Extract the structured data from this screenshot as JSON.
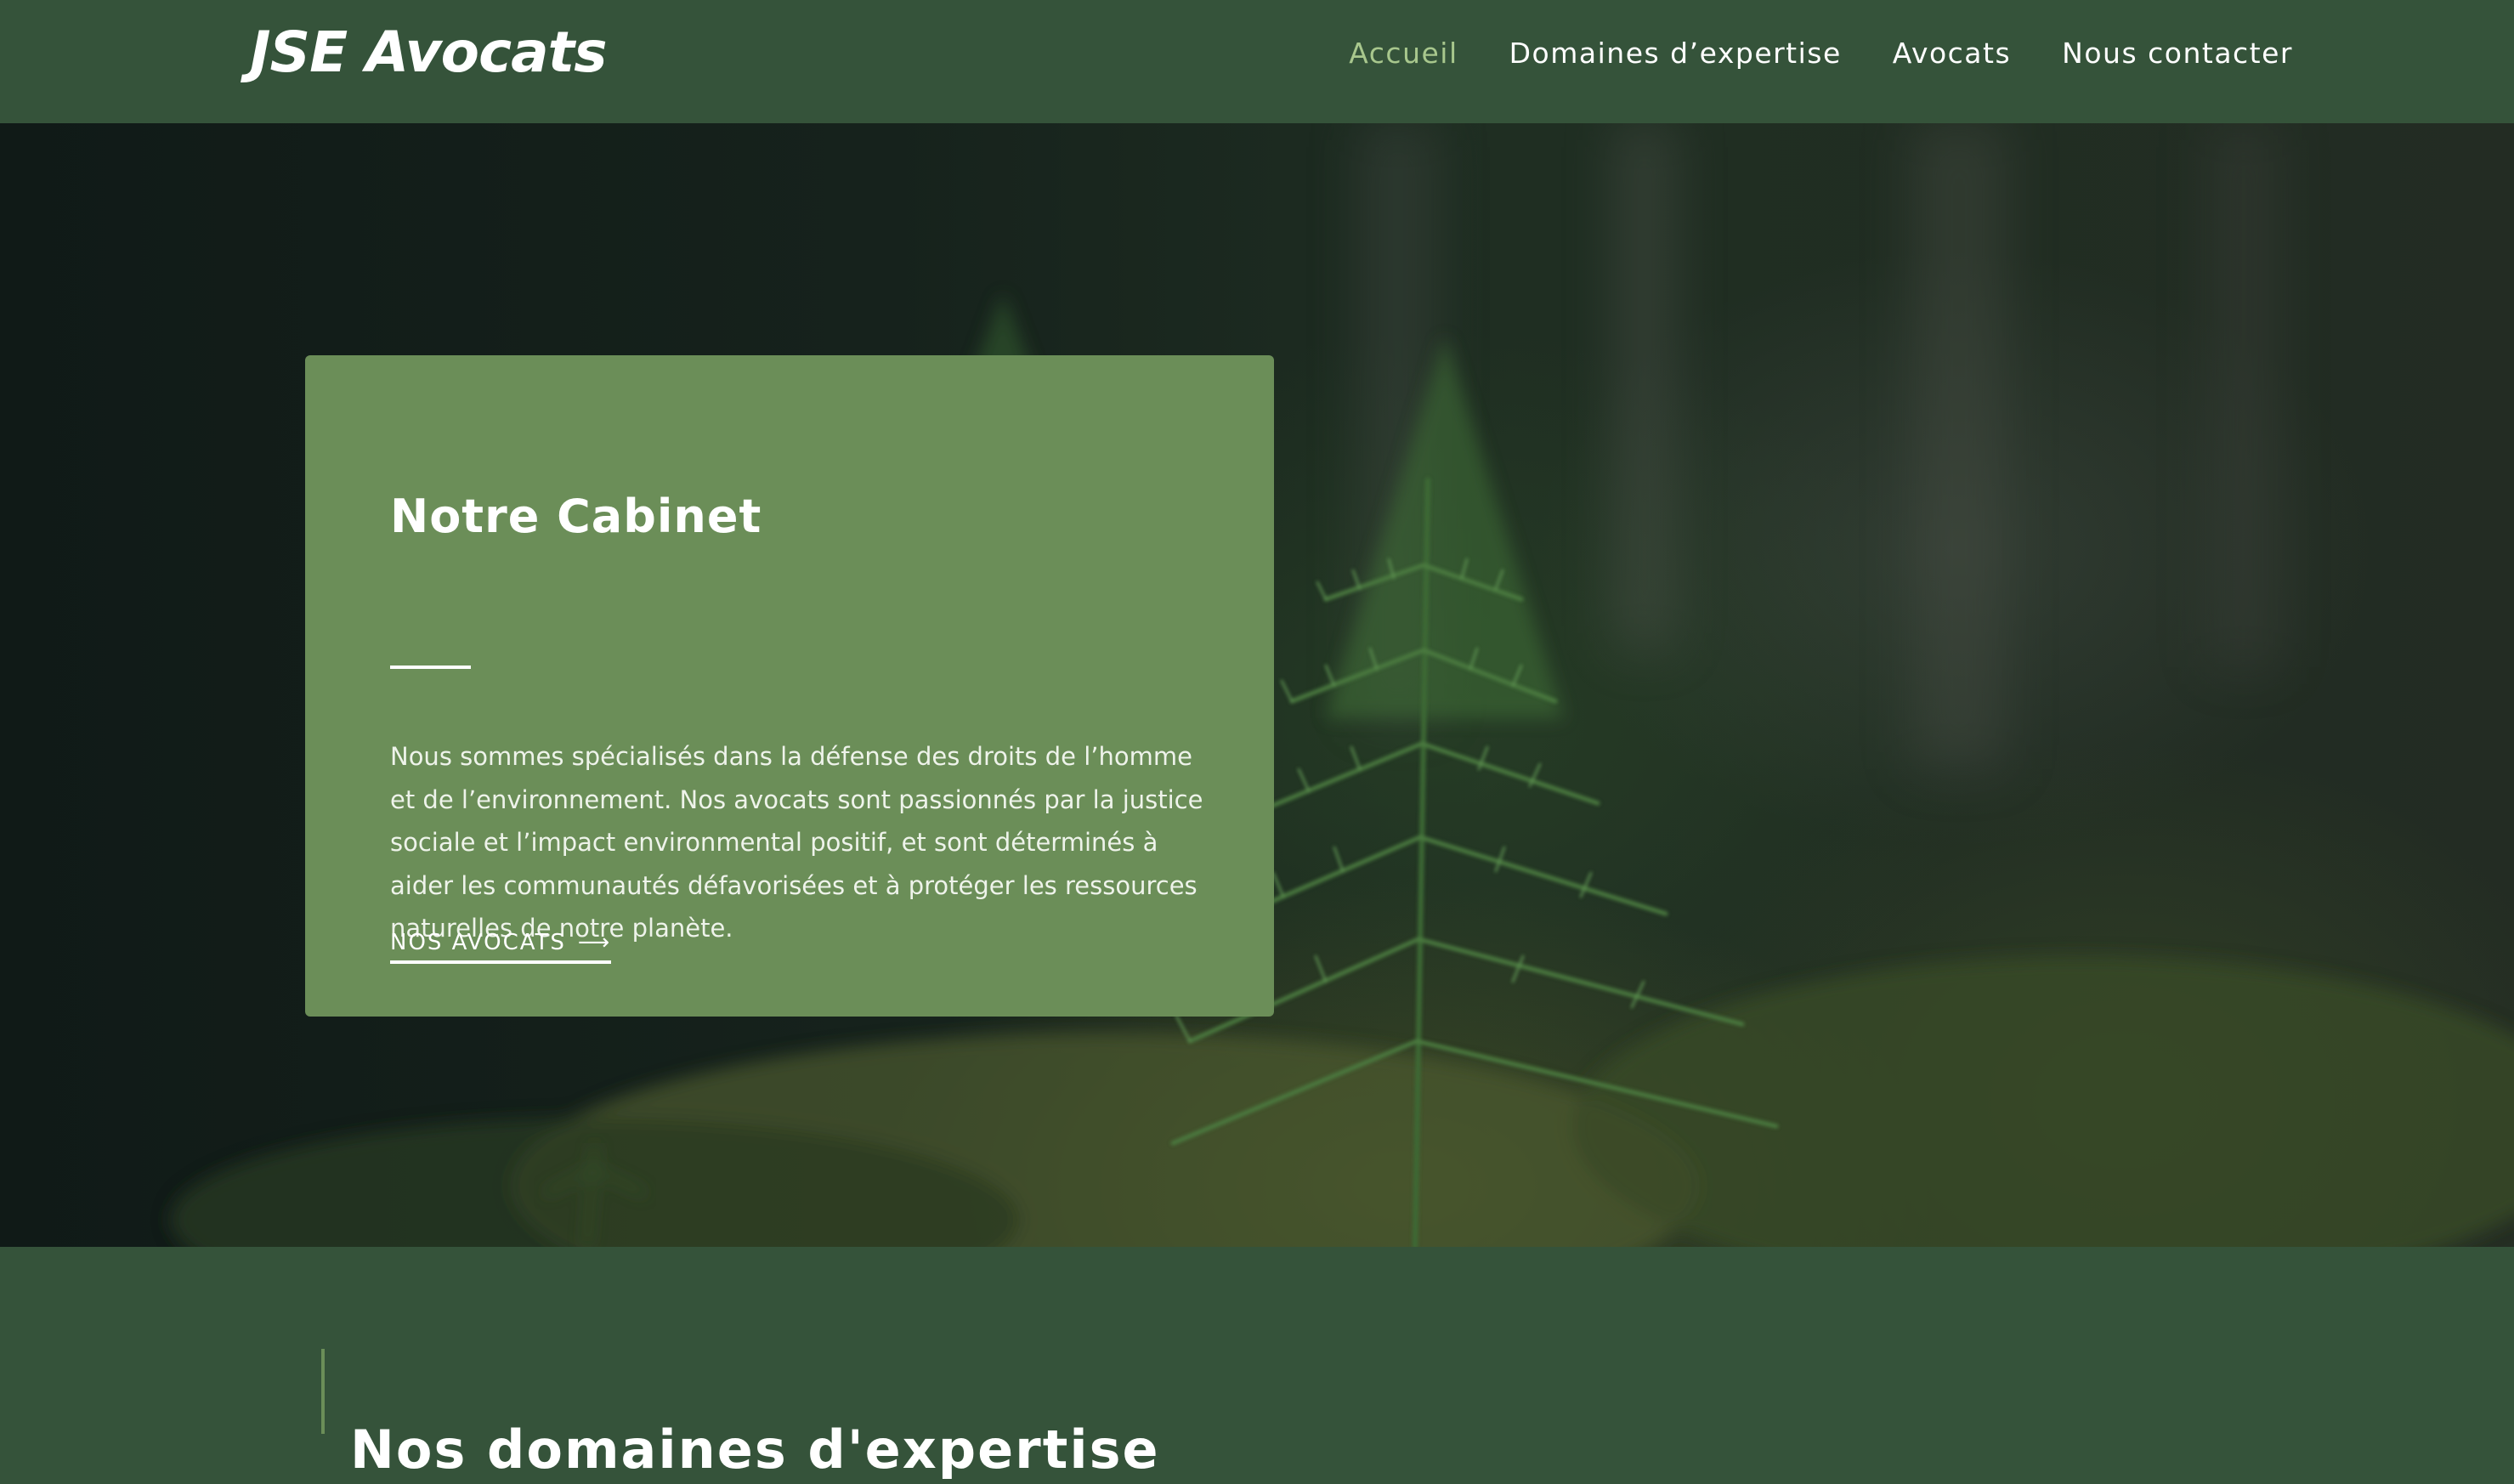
{
  "header": {
    "logo": "JSE Avocats",
    "nav": [
      {
        "label": "Accueil",
        "active": true
      },
      {
        "label": "Domaines d’expertise",
        "active": false
      },
      {
        "label": "Avocats",
        "active": false
      },
      {
        "label": "Nous contacter",
        "active": false
      }
    ]
  },
  "hero": {
    "background_image": "forest-seedling-photo",
    "card": {
      "title": "Notre Cabinet",
      "text": "Nous sommes spécialisés dans la défense des droits de l’homme et de l’environnement. Nos avocats sont passionnés par la justice sociale et l’impact environmental positif, et sont déterminés à aider les communautés défavorisées et à protéger les ressources naturelles de notre planète.",
      "link_label": "NOS AVOCATS",
      "link_icon": "arrow-right-icon"
    }
  },
  "expertise": {
    "title": "Nos domaines d'expertise"
  },
  "colors": {
    "header_bg": "#35533a",
    "card_bg": "#6b8e58",
    "active_nav": "#a8c78d",
    "text": "#ffffff"
  }
}
